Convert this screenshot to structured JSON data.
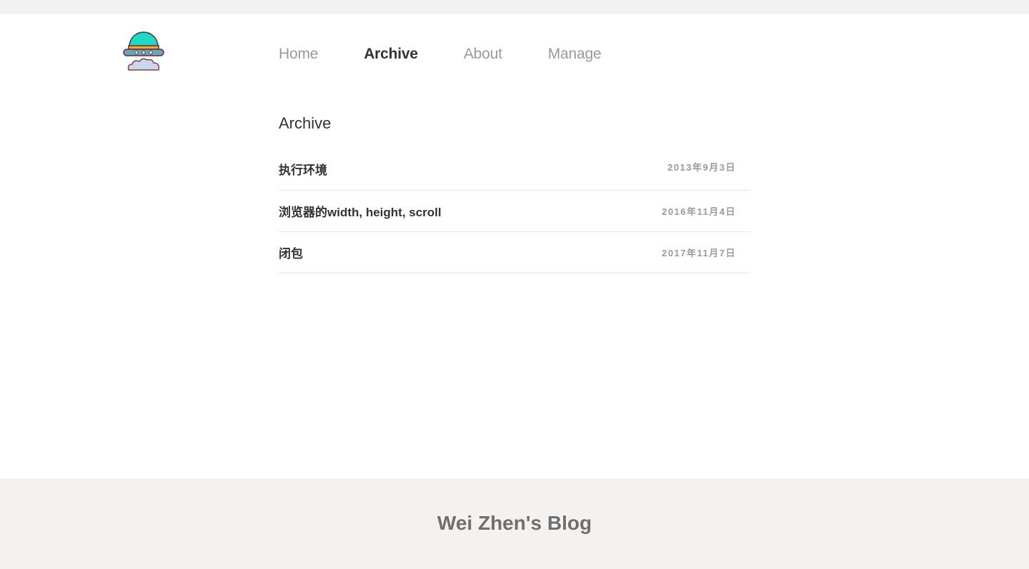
{
  "logo": {
    "icon": "ufo-icon"
  },
  "nav": {
    "items": [
      {
        "label": "Home",
        "active": false
      },
      {
        "label": "Archive",
        "active": true
      },
      {
        "label": "About",
        "active": false
      },
      {
        "label": "Manage",
        "active": false
      }
    ]
  },
  "main": {
    "title": "Archive",
    "posts": [
      {
        "title": "执行环境",
        "date": "2013年9月3日"
      },
      {
        "title": "浏览器的width, height, scroll",
        "date": "2016年11月4日"
      },
      {
        "title": "闭包",
        "date": "2017年11月7日"
      }
    ]
  },
  "footer": {
    "title": "Wei Zhen's Blog"
  },
  "colors": {
    "background": "#f3f2f0",
    "text": "#333333",
    "muted": "#9a9a9a",
    "ufo_dome": "#1ed9c4",
    "ufo_band": "#f5a623",
    "ufo_body": "#6ba3b8"
  }
}
